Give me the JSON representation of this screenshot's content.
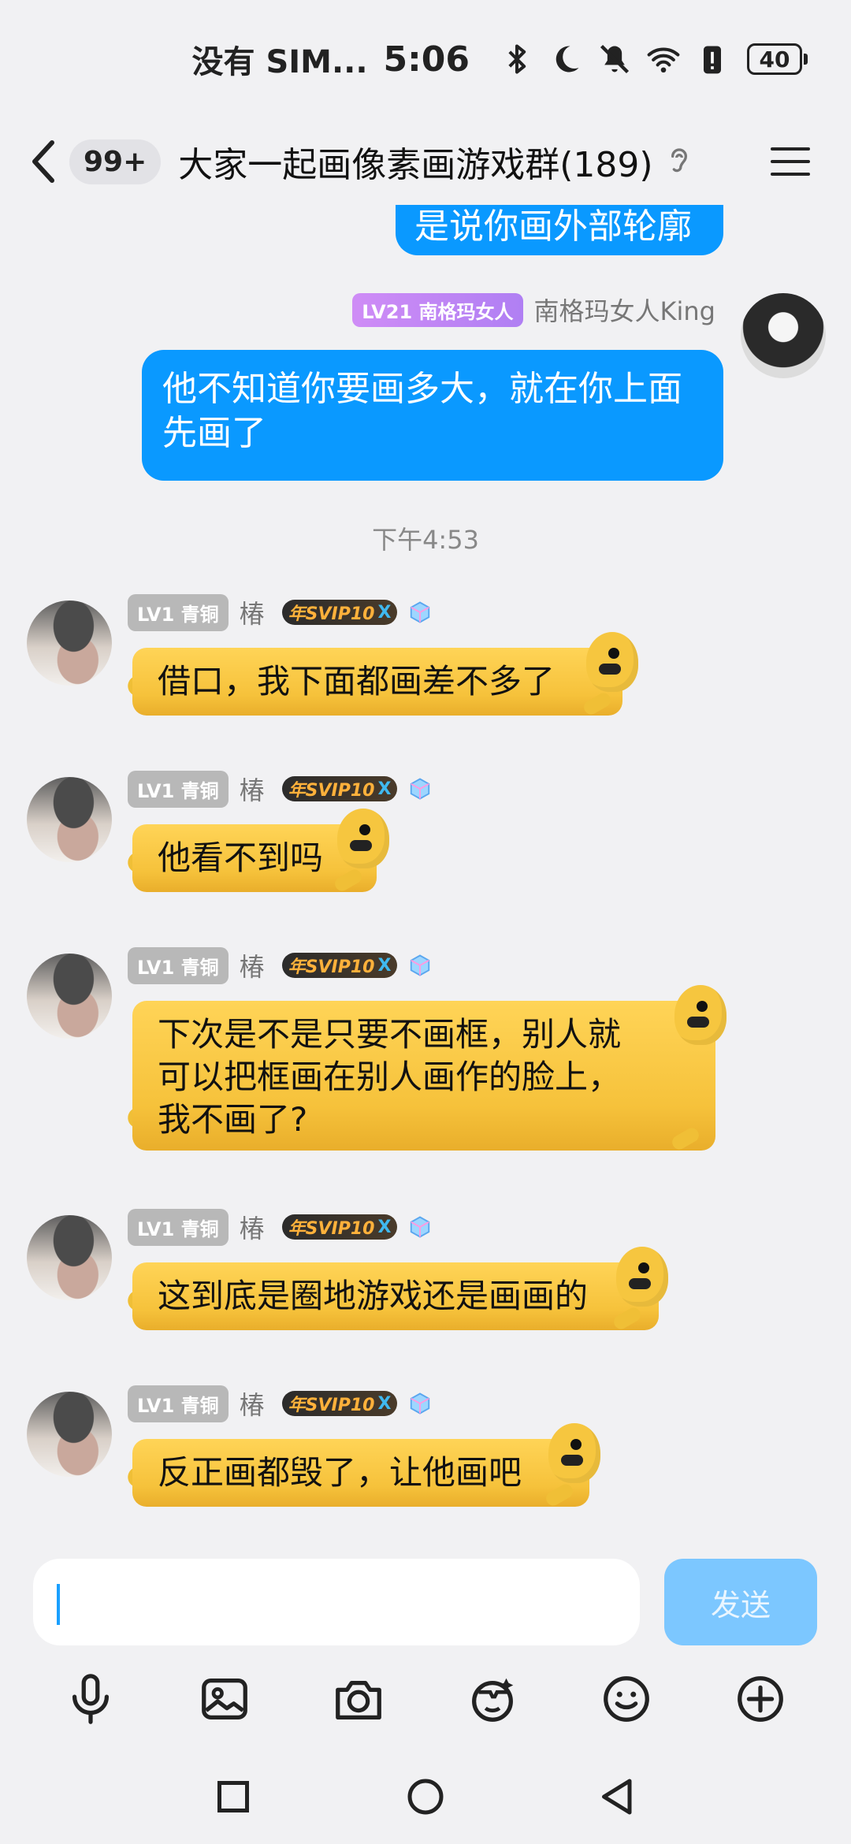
{
  "status_bar": {
    "carrier": "没有 SIM...",
    "time": "5:06",
    "battery": "40",
    "icons": [
      "bluetooth-icon",
      "moon-icon",
      "mute-icon",
      "wifi-icon",
      "battery-alert-icon"
    ]
  },
  "header": {
    "unread_badge": "99+",
    "title": "大家一起画像素画游戏群(189)",
    "back_icon": "chevron-left-icon",
    "ear_icon": "ear-icon",
    "menu_icon": "hamburger-menu-icon"
  },
  "chat": {
    "top_partial_message": "是说你画外部轮廓",
    "own_message": {
      "level_badge": "LV21 南格玛女人",
      "sender": "南格玛女人King",
      "text_line1": "他不知道你要画多大，就在你上面",
      "text_line2": "先画了"
    },
    "timestamp": "下午4:53",
    "messages": [
      {
        "level_badge": "LV1 青铜",
        "sender": "椿",
        "svip": "年SVIP10",
        "svip_x": "X",
        "lines": [
          "借口，我下面都画差不多了"
        ]
      },
      {
        "level_badge": "LV1 青铜",
        "sender": "椿",
        "svip": "年SVIP10",
        "svip_x": "X",
        "lines": [
          "他看不到吗"
        ]
      },
      {
        "level_badge": "LV1 青铜",
        "sender": "椿",
        "svip": "年SVIP10",
        "svip_x": "X",
        "lines": [
          "下次是不是只要不画框，别人就",
          "可以把框画在别人画作的脸上，",
          "我不画了?"
        ]
      },
      {
        "level_badge": "LV1 青铜",
        "sender": "椿",
        "svip": "年SVIP10",
        "svip_x": "X",
        "lines": [
          "这到底是圈地游戏还是画画的"
        ]
      },
      {
        "level_badge": "LV1 青铜",
        "sender": "椿",
        "svip": "年SVIP10",
        "svip_x": "X",
        "lines": [
          "反正画都毁了，让他画吧"
        ]
      }
    ]
  },
  "input": {
    "value": "",
    "send_label": "发送"
  },
  "toolbar": {
    "icons": [
      "microphone-icon",
      "image-icon",
      "camera-icon",
      "sticker-icon",
      "emoji-icon",
      "plus-icon"
    ]
  },
  "navbar": {
    "icons": [
      "recents-square-icon",
      "home-circle-icon",
      "back-triangle-icon"
    ]
  },
  "colors": {
    "bubble_blue": "#0a99ff",
    "send_button": "#7cc7ff",
    "background": "#f1f1f3",
    "duck_yellow": "#f6c23b"
  }
}
